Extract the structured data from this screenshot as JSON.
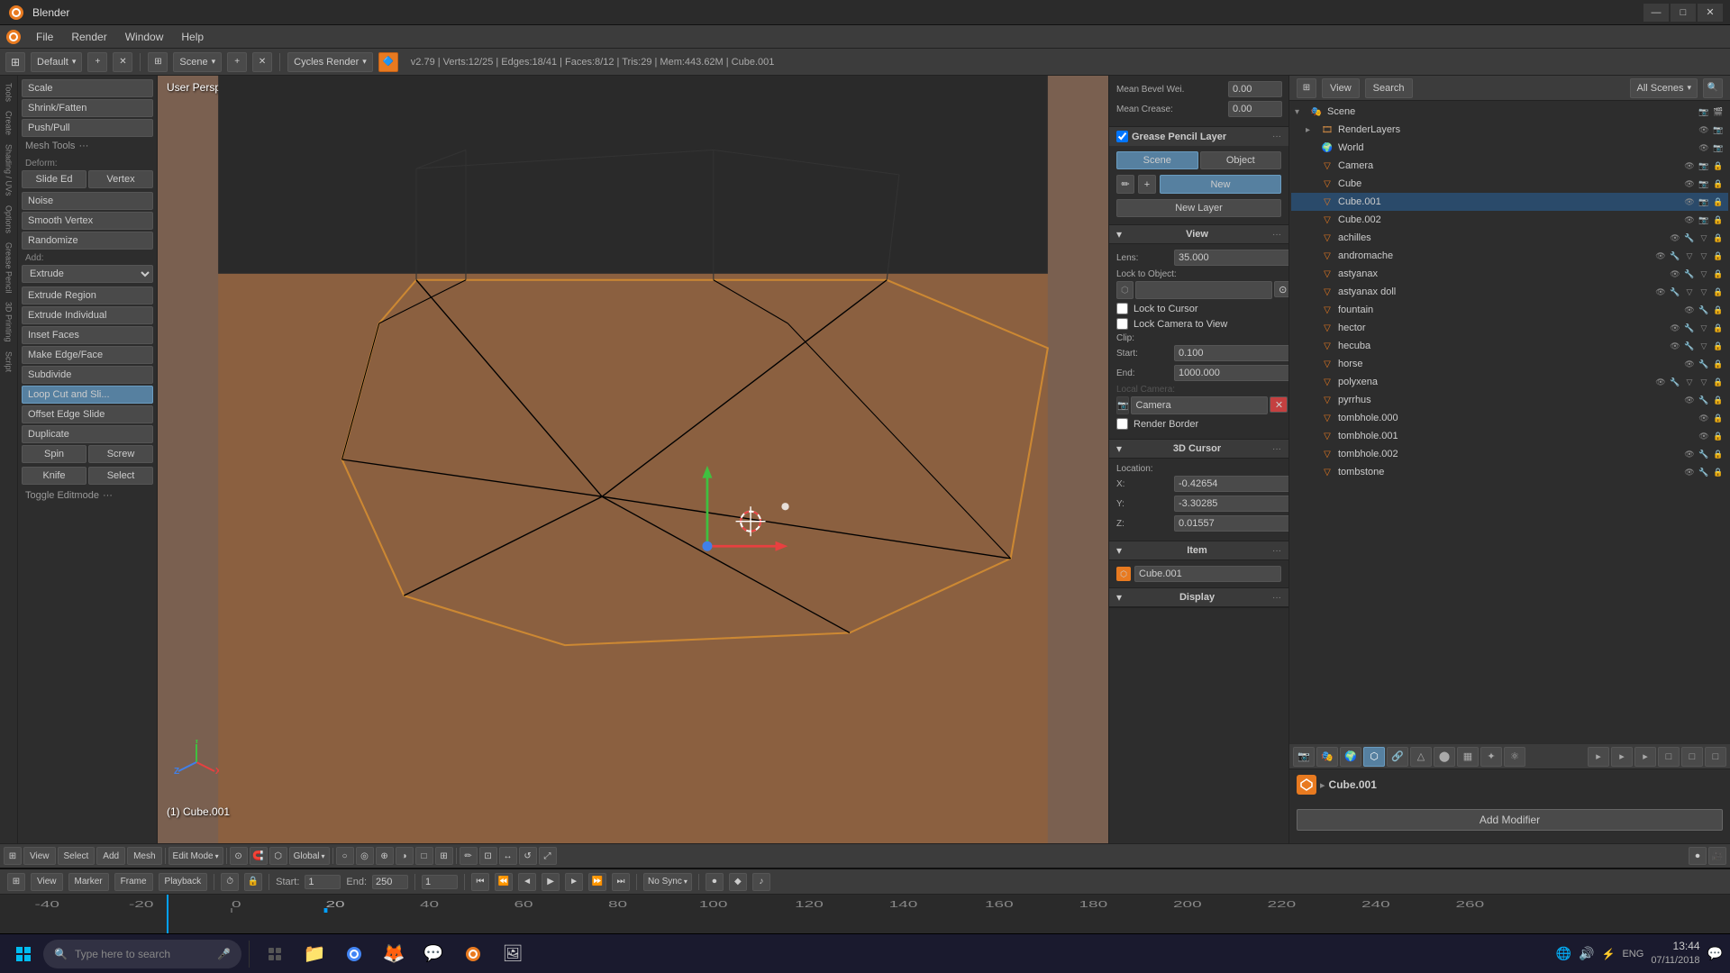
{
  "titlebar": {
    "title": "Blender",
    "minimize": "—",
    "maximize": "□",
    "close": "✕"
  },
  "menubar": {
    "items": [
      "File",
      "Render",
      "Window",
      "Help"
    ]
  },
  "header": {
    "engine": "Cycles Render",
    "scene": "Scene",
    "layout": "Default",
    "stats": "v2.79 | Verts:12/25 | Edges:18/41 | Faces:8/12 | Tris:29 | Mem:443.62M | Cube.001"
  },
  "tools": {
    "deform": {
      "label": "Deform:",
      "slide_ed": "Slide Ed",
      "vertex": "Vertex",
      "noise": "Noise",
      "smooth_vertex": "Smooth Vertex",
      "randomize": "Randomize"
    },
    "add": {
      "label": "Add:",
      "extrude": "Extrude",
      "extrude_region": "Extrude Region",
      "extrude_individual": "Extrude Individual",
      "inset_faces": "Inset Faces",
      "make_edge_face": "Make Edge/Face",
      "subdivide": "Subdivide",
      "loop_cut": "Loop Cut and Sli...",
      "offset_edge_slide": "Offset Edge Slide",
      "duplicate": "Duplicate",
      "spin": "Spin",
      "screw": "Screw",
      "knife": "Knife",
      "select": "Select"
    },
    "scale": "Scale",
    "shrink_fatten": "Shrink/Fatten",
    "push_pull": "Push/Pull",
    "mesh_tools": "Mesh Tools",
    "toggle_editmode": "Toggle Editmode"
  },
  "viewport": {
    "label": "User Persp",
    "object_label": "(1) Cube.001"
  },
  "properties_panel": {
    "view_section": "View",
    "lens_label": "Lens:",
    "lens_value": "35.000",
    "lock_to_object_label": "Lock to Object:",
    "lock_to_cursor": "Lock to Cursor",
    "lock_camera_to_view": "Lock Camera to View",
    "clip_label": "Clip:",
    "start_label": "Start:",
    "start_value": "0.100",
    "end_label": "End:",
    "end_value": "1000.000",
    "local_camera_label": "Local Camera:",
    "camera_value": "Camera",
    "render_border": "Render Border",
    "cursor_section": "3D Cursor",
    "location_label": "Location:",
    "x_label": "X:",
    "x_value": "-0.42654",
    "y_label": "Y:",
    "y_value": "-3.30285",
    "z_label": "Z:",
    "z_value": "0.01557",
    "item_section": "Item",
    "item_name": "Cube.001",
    "display_section": "Display",
    "grease_pencil_section": "Grease Pencil Layer",
    "new_button": "New",
    "new_layer_button": "New Layer",
    "scene_btn": "Scene",
    "object_btn": "Object",
    "mean_bevel_label": "Mean Bevel Wei.",
    "mean_bevel_value": "0.00",
    "mean_crease_label": "Mean Crease:",
    "mean_crease_value": "0.00"
  },
  "outliner": {
    "header_title": "All Scenes",
    "view_btn": "View",
    "search_btn": "Search",
    "scene": "Scene",
    "items": [
      {
        "name": "Scene",
        "type": "scene",
        "indent": 0,
        "expanded": true
      },
      {
        "name": "RenderLayers",
        "type": "renderlayers",
        "indent": 1,
        "expanded": false
      },
      {
        "name": "World",
        "type": "world",
        "indent": 1,
        "expanded": false
      },
      {
        "name": "Camera",
        "type": "camera",
        "indent": 1,
        "expanded": false
      },
      {
        "name": "Cube",
        "type": "mesh",
        "indent": 1,
        "expanded": false
      },
      {
        "name": "Cube.001",
        "type": "mesh",
        "indent": 1,
        "expanded": false,
        "selected": true
      },
      {
        "name": "Cube.002",
        "type": "mesh",
        "indent": 1,
        "expanded": false
      },
      {
        "name": "achilles",
        "type": "mesh",
        "indent": 1,
        "expanded": false
      },
      {
        "name": "andromache",
        "type": "mesh",
        "indent": 1,
        "expanded": false
      },
      {
        "name": "astyanax",
        "type": "mesh",
        "indent": 1,
        "expanded": false
      },
      {
        "name": "astyanax doll",
        "type": "mesh",
        "indent": 1,
        "expanded": false
      },
      {
        "name": "fountain",
        "type": "mesh",
        "indent": 1,
        "expanded": false
      },
      {
        "name": "hector",
        "type": "mesh",
        "indent": 1,
        "expanded": false
      },
      {
        "name": "hecuba",
        "type": "mesh",
        "indent": 1,
        "expanded": false
      },
      {
        "name": "horse",
        "type": "mesh",
        "indent": 1,
        "expanded": false
      },
      {
        "name": "polyxena",
        "type": "mesh",
        "indent": 1,
        "expanded": false
      },
      {
        "name": "pyrrhus",
        "type": "mesh",
        "indent": 1,
        "expanded": false
      },
      {
        "name": "tombhole.000",
        "type": "mesh",
        "indent": 1,
        "expanded": false
      },
      {
        "name": "tombhole.001",
        "type": "mesh",
        "indent": 1,
        "expanded": false
      },
      {
        "name": "tombhole.002",
        "type": "mesh",
        "indent": 1,
        "expanded": false
      },
      {
        "name": "tombstone",
        "type": "mesh",
        "indent": 1,
        "expanded": false
      }
    ]
  },
  "object_props": {
    "add_modifier": "Add Modifier",
    "cube_name": "Cube.001"
  },
  "timeline": {
    "start_label": "Start:",
    "start_value": "1",
    "end_label": "End:",
    "end_value": "250",
    "frame_value": "1",
    "sync": "No Sync",
    "numbers": [
      "-40",
      "-20",
      "0",
      "20",
      "40",
      "60",
      "80",
      "100",
      "120",
      "140",
      "160",
      "180",
      "200",
      "220",
      "240",
      "260"
    ]
  },
  "viewport_toolbar": {
    "view": "View",
    "select": "Select",
    "add": "Add",
    "mesh": "Mesh",
    "mode": "Edit Mode",
    "pivot": "Global"
  },
  "taskbar": {
    "search_placeholder": "Type here to search",
    "time": "13:44",
    "date": "07/11/2018",
    "lang": "ENG"
  },
  "icons": {
    "blender_logo": "🔷",
    "windows_logo": "⊞",
    "search": "🔍",
    "mic": "🎤",
    "folder": "📁",
    "chrome": "⚪",
    "firefox": "🦊",
    "discord": "💬",
    "blender_app": "🔷",
    "photos": "🖼",
    "gear": "⚙",
    "triangle_down": "▾",
    "triangle_right": "▸",
    "eye": "👁",
    "camera": "📷",
    "dot": "•",
    "lock": "🔒",
    "cursor": "⊕",
    "expand": "▾",
    "collapse": "▸",
    "render_icon": "🎬",
    "scene_icon": "🎭",
    "world_icon": "🌍",
    "object_icon": "⬡",
    "constraint_icon": "🔗",
    "data_icon": "📊",
    "material_icon": "⬤",
    "texture_icon": "▦",
    "physics_icon": "⚛",
    "particle_icon": "✦"
  }
}
